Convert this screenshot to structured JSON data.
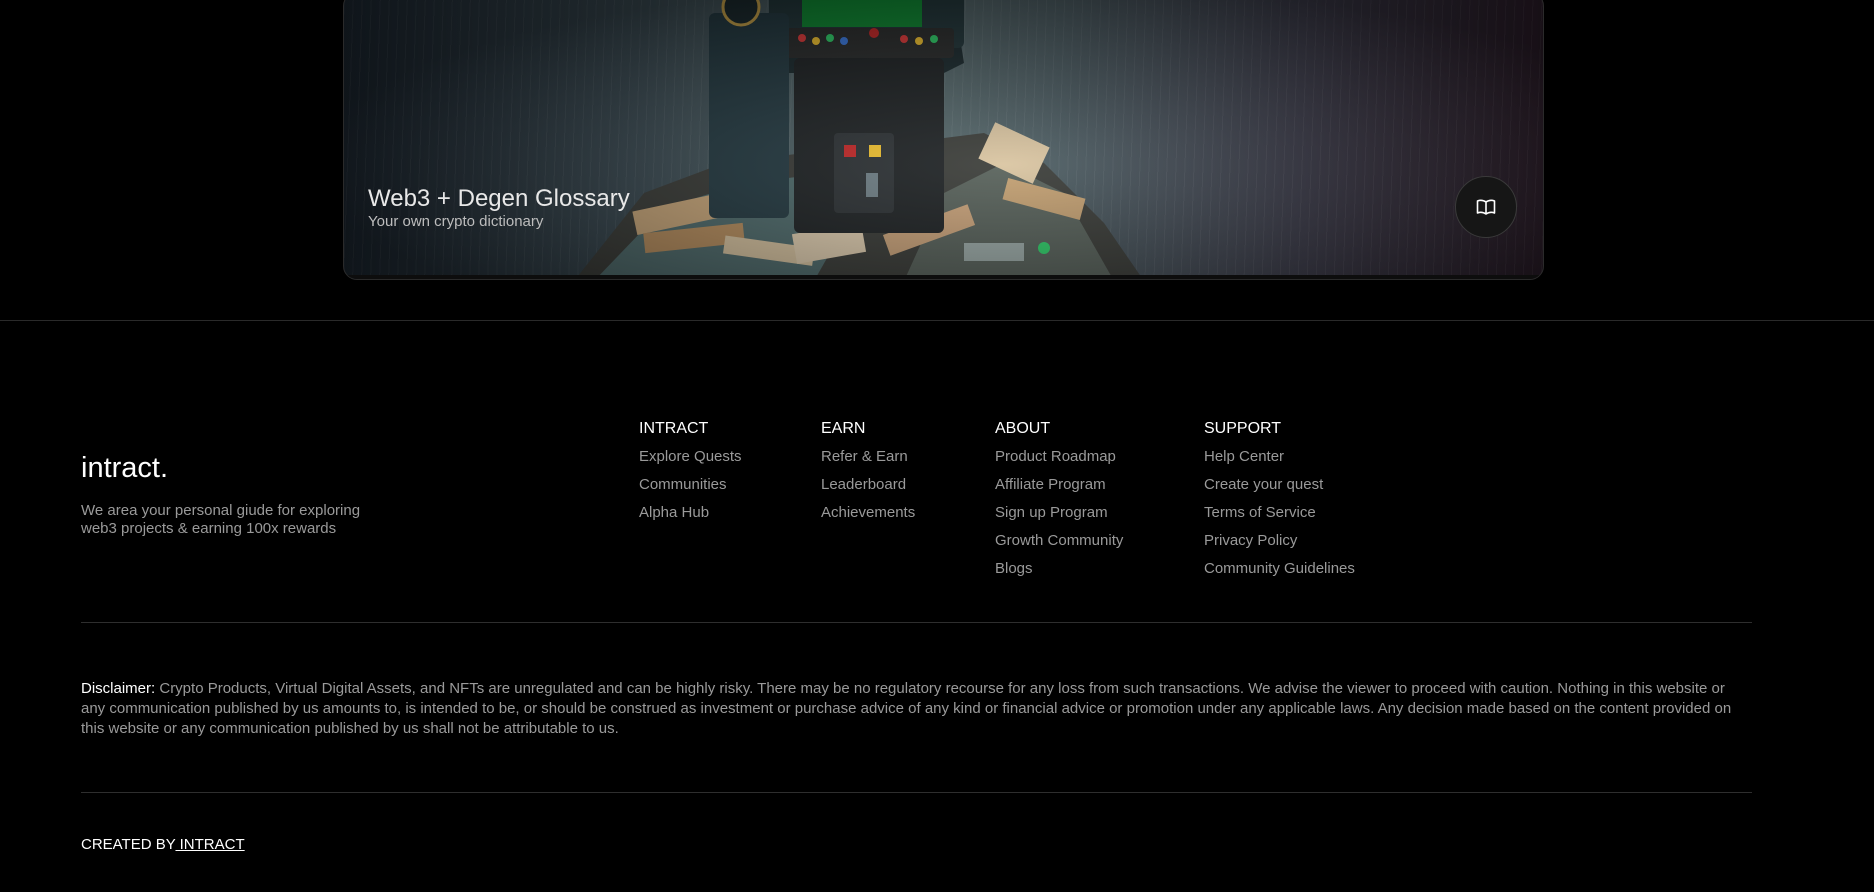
{
  "banner": {
    "title": "Web3 + Degen Glossary",
    "subtitle": "Your own crypto dictionary",
    "button_icon": "book-icon"
  },
  "footer": {
    "brand": "intract.",
    "tagline": "We area your personal giude for exploring web3 projects & earning 100x rewards",
    "columns": [
      {
        "heading": "INTRACT",
        "links": [
          "Explore Quests",
          "Communities",
          "Alpha Hub"
        ]
      },
      {
        "heading": "EARN",
        "links": [
          "Refer & Earn",
          "Leaderboard",
          "Achievements"
        ]
      },
      {
        "heading": "ABOUT",
        "links": [
          "Product Roadmap",
          "Affiliate Program",
          "Sign up Program",
          "Growth Community",
          "Blogs"
        ]
      },
      {
        "heading": "SUPPORT",
        "links": [
          "Help Center",
          "Create your quest",
          "Terms of Service",
          "Privacy Policy",
          "Community Guidelines"
        ]
      }
    ],
    "disclaimer_label": "Disclaimer:",
    "disclaimer_text": " Crypto Products, Virtual Digital Assets, and NFTs are unregulated and can be highly risky. There may be no regulatory recourse for any loss from such transactions. We advise the viewer to proceed with caution. Nothing in this website or any communication published by us amounts to, is intended to be, or should be construed as investment or purchase advice of any kind or financial advice or promotion under any applicable laws. Any decision made based on the content provided on this website or any communication published by us shall not be attributable to us.",
    "created_prefix": "CREATED BY",
    "created_link": " INTRACT"
  }
}
